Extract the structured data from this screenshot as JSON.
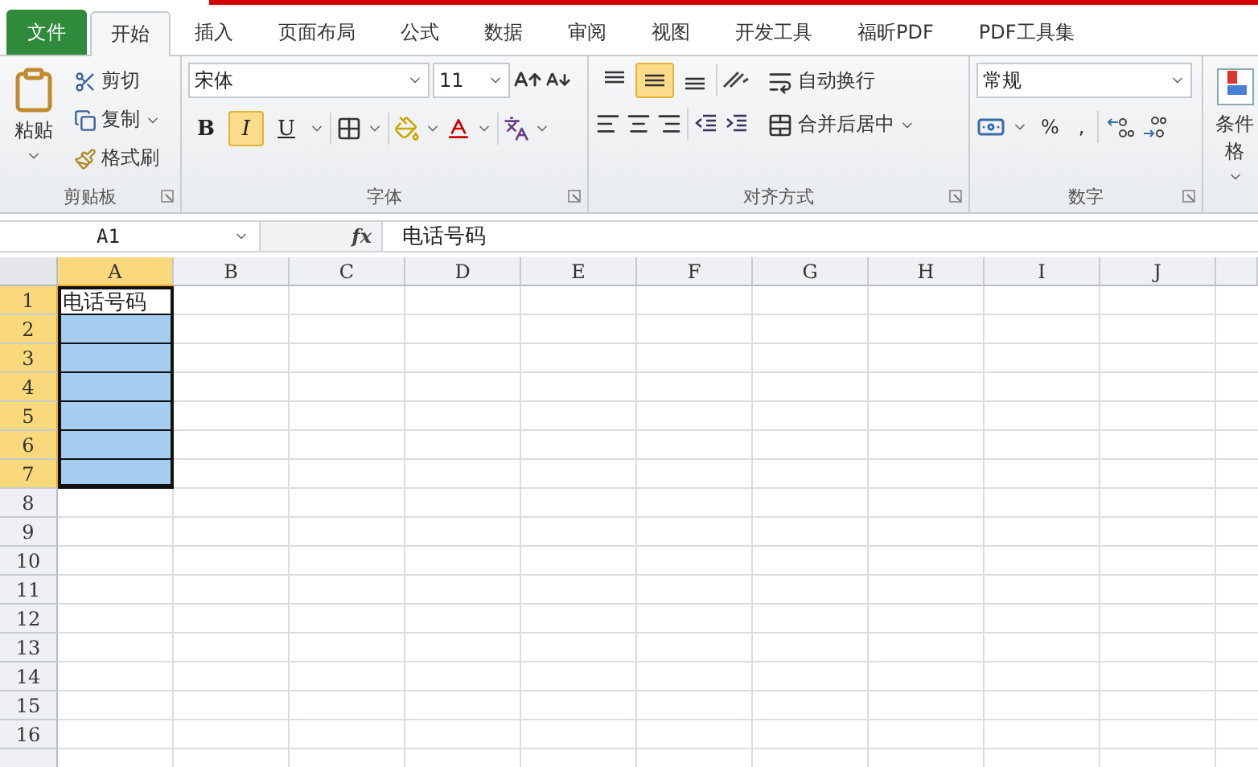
{
  "tabs": [
    {
      "label": "文件",
      "kind": "file",
      "selected": false
    },
    {
      "label": "开始",
      "kind": "tab",
      "selected": true
    },
    {
      "label": "插入",
      "kind": "tab",
      "selected": false
    },
    {
      "label": "页面布局",
      "kind": "tab",
      "selected": false
    },
    {
      "label": "公式",
      "kind": "tab",
      "selected": false
    },
    {
      "label": "数据",
      "kind": "tab",
      "selected": false
    },
    {
      "label": "审阅",
      "kind": "tab",
      "selected": false
    },
    {
      "label": "视图",
      "kind": "tab",
      "selected": false
    },
    {
      "label": "开发工具",
      "kind": "tab",
      "selected": false
    },
    {
      "label": "福昕PDF",
      "kind": "tab",
      "selected": false
    },
    {
      "label": "PDF工具集",
      "kind": "tab",
      "selected": false
    }
  ],
  "clipboard": {
    "paste": "粘贴",
    "cut": "剪切",
    "copy": "复制",
    "format_painter": "格式刷",
    "group_label": "剪贴板"
  },
  "font": {
    "name": "宋体",
    "size": "11",
    "styles": [
      {
        "label": "B",
        "kind": "bold",
        "selected": false
      },
      {
        "label": "I",
        "kind": "italic",
        "selected": true
      },
      {
        "label": "U",
        "kind": "underline",
        "selected": false
      }
    ],
    "group_label": "字体"
  },
  "alignment": {
    "vertical": [
      {
        "kind": "top",
        "selected": false
      },
      {
        "kind": "middle",
        "selected": true
      },
      {
        "kind": "bottom",
        "selected": false
      }
    ],
    "wrap": "自动换行",
    "merge": "合并后居中",
    "group_label": "对齐方式"
  },
  "number": {
    "format": "常规",
    "percent": "%",
    "comma": ",",
    "group_label": "数字"
  },
  "styles": {
    "conditional": "条件格"
  },
  "formula_bar": {
    "name_box": "A1",
    "fx": "fx",
    "value": "电话号码"
  },
  "grid": {
    "columns": [
      {
        "label": "A",
        "selected": true
      },
      {
        "label": "B",
        "selected": false
      },
      {
        "label": "C",
        "selected": false
      },
      {
        "label": "D",
        "selected": false
      },
      {
        "label": "E",
        "selected": false
      },
      {
        "label": "F",
        "selected": false
      },
      {
        "label": "G",
        "selected": false
      },
      {
        "label": "H",
        "selected": false
      },
      {
        "label": "I",
        "selected": false
      },
      {
        "label": "J",
        "selected": false
      }
    ],
    "rows": [
      {
        "label": "1",
        "selected": true,
        "cell_a": {
          "text": "电话号码",
          "selected": false
        }
      },
      {
        "label": "2",
        "selected": true,
        "cell_a": {
          "selected": true
        }
      },
      {
        "label": "3",
        "selected": true,
        "cell_a": {
          "selected": true
        }
      },
      {
        "label": "4",
        "selected": true,
        "cell_a": {
          "selected": true
        }
      },
      {
        "label": "5",
        "selected": true,
        "cell_a": {
          "selected": true
        }
      },
      {
        "label": "6",
        "selected": true,
        "cell_a": {
          "selected": true
        }
      },
      {
        "label": "7",
        "selected": true,
        "cell_a": {
          "selected": true
        }
      },
      {
        "label": "8",
        "selected": false
      },
      {
        "label": "9",
        "selected": false
      },
      {
        "label": "10",
        "selected": false
      },
      {
        "label": "11",
        "selected": false
      },
      {
        "label": "12",
        "selected": false
      },
      {
        "label": "13",
        "selected": false
      },
      {
        "label": "14",
        "selected": false
      },
      {
        "label": "15",
        "selected": false
      },
      {
        "label": "16",
        "selected": false
      }
    ]
  }
}
